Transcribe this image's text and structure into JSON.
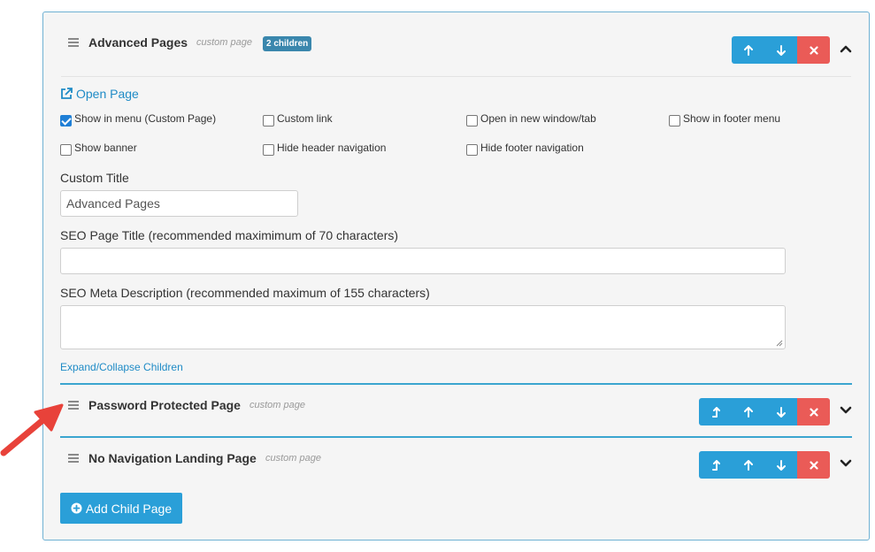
{
  "parent": {
    "name": "Advanced Pages",
    "type": "custom page",
    "badge": "2 children",
    "open_page_label": "Open Page",
    "checkboxes": [
      {
        "label": "Show in menu (Custom Page)",
        "checked": true
      },
      {
        "label": "Custom link",
        "checked": false
      },
      {
        "label": "Open in new window/tab",
        "checked": false
      },
      {
        "label": "Show in footer menu",
        "checked": false
      },
      {
        "label": "Show banner",
        "checked": false
      },
      {
        "label": "Hide header navigation",
        "checked": false
      },
      {
        "label": "Hide footer navigation",
        "checked": false
      }
    ],
    "custom_title_label": "Custom Title",
    "custom_title_value": "Advanced Pages",
    "seo_title_label": "SEO Page Title (recommended maximimum of 70 characters)",
    "seo_title_value": "",
    "seo_desc_label": "SEO Meta Description (recommended maximum of 155 characters)",
    "seo_desc_value": "",
    "expand_collapse_label": "Expand/Collapse Children"
  },
  "children": [
    {
      "name": "Password Protected Page",
      "type": "custom page"
    },
    {
      "name": "No Navigation Landing Page",
      "type": "custom page"
    }
  ],
  "add_child_label": "Add Child Page",
  "colors": {
    "accent": "#2a9fd8",
    "danger": "#ea5b57",
    "badge": "#3a87ad",
    "border": "#6fb1d3",
    "arrow": "#e8423a"
  },
  "icons": {
    "drag": "drag-handle-icon",
    "up": "arrow-up-icon",
    "down": "arrow-down-icon",
    "promote": "promote-level-icon",
    "remove": "close-icon",
    "collapse": "chevron-up-icon",
    "expand": "chevron-down-icon",
    "external": "external-link-icon",
    "add": "plus-circle-icon"
  }
}
